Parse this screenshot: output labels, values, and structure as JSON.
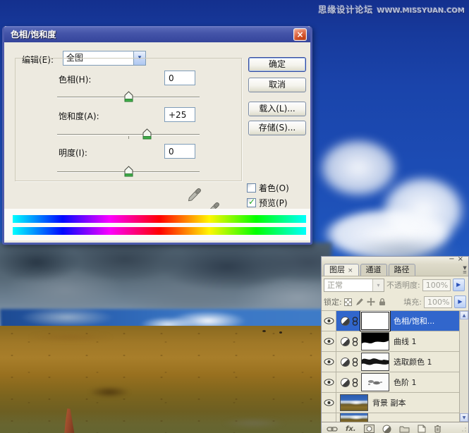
{
  "watermark": {
    "site": "思缘设计论坛",
    "url": "WWW.MISSYUAN.COM"
  },
  "dialog": {
    "title": "色相/饱和度",
    "close_glyph": "×",
    "edit_label": "编辑(E):",
    "edit_value": "全图",
    "sliders": [
      {
        "label": "色相(H):",
        "value": "0"
      },
      {
        "label": "饱和度(A):",
        "value": "+25"
      },
      {
        "label": "明度(I):",
        "value": "0"
      }
    ],
    "buttons": {
      "ok": "确定",
      "cancel": "取消",
      "load": "载入(L)...",
      "save": "存储(S)..."
    },
    "checkboxes": {
      "colorize": "着色(O)",
      "preview": "预览(P)",
      "check_glyph": "✓"
    }
  },
  "layers_panel": {
    "window_minimize": "−",
    "window_close": "×",
    "tabs": [
      {
        "label": "图层"
      },
      {
        "label": "通道"
      },
      {
        "label": "路径"
      }
    ],
    "tab_close_glyph": "×",
    "blend_mode": "正常",
    "opacity_label": "不透明度:",
    "opacity_value": "100%",
    "lock_label": "锁定:",
    "fill_label": "填充:",
    "fill_value": "100%",
    "layers": [
      {
        "name": "色相/饱和..."
      },
      {
        "name": "曲线 1"
      },
      {
        "name": "选取颜色 1"
      },
      {
        "name": "色阶 1"
      },
      {
        "name": "背景 副本"
      }
    ],
    "toolbar_fx_label": "fx."
  },
  "icons": {
    "combo_arrow": "▾",
    "spin_arrow": "▶",
    "panel_menu_arrow": "▼",
    "panel_menu_lines": "≡",
    "scroll_up": "▲",
    "scroll_down": "▼"
  },
  "colors": {
    "selection_blue": "#3166cc",
    "titlebar_blue": "#4454a8",
    "check_green": "#1ea621",
    "dialog_face": "#EDEAE0"
  }
}
